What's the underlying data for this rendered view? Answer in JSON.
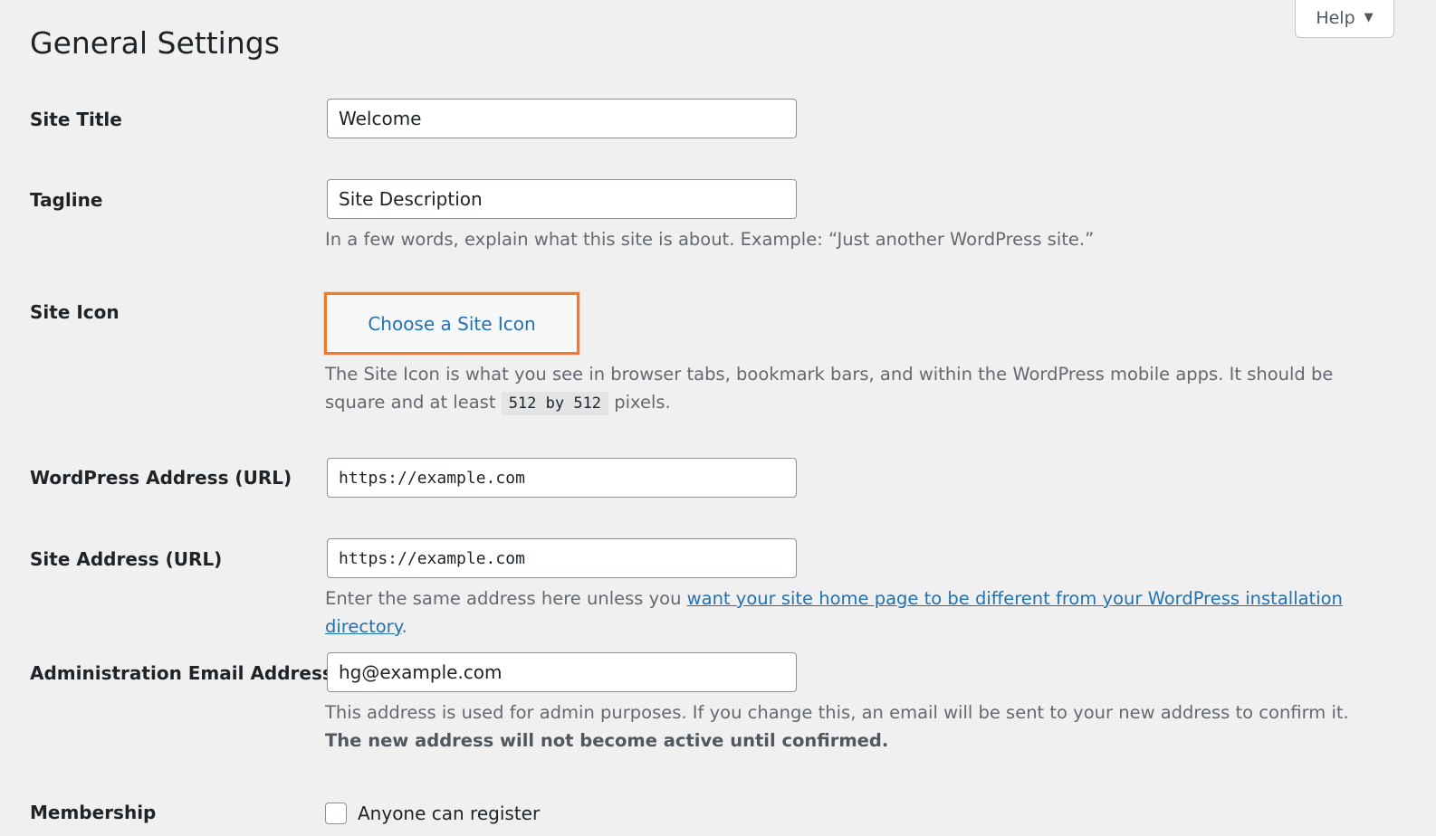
{
  "help": {
    "label": "Help",
    "caret": "▼"
  },
  "page_title": "General Settings",
  "site_title": {
    "label": "Site Title",
    "value": "Welcome"
  },
  "tagline": {
    "label": "Tagline",
    "value": "Site Description",
    "description": "In a few words, explain what this site is about. Example: “Just another WordPress site.”"
  },
  "site_icon": {
    "label": "Site Icon",
    "button_label": "Choose a Site Icon",
    "description_start": "The Site Icon is what you see in browser tabs, bookmark bars, and within the WordPress mobile apps. It should be square and at least ",
    "description_code": "512 by 512",
    "description_end": " pixels."
  },
  "wp_address": {
    "label": "WordPress Address (URL)",
    "value": "https://example.com"
  },
  "site_address": {
    "label": "Site Address (URL)",
    "value": "https://example.com",
    "description_start": "Enter the same address here unless you ",
    "description_link": "want your site home page to be different from your WordPress installation directory",
    "description_end": "."
  },
  "admin_email": {
    "label": "Administration Email Address",
    "value": "hg@example.com",
    "description_start": "This address is used for admin purposes. If you change this, an email will be sent to your new address to confirm it. ",
    "description_strong": "The new address will not become active until confirmed."
  },
  "membership": {
    "label": "Membership",
    "checkbox_label": "Anyone can register",
    "checked": false
  },
  "colors": {
    "accent_highlight": "#f07a2a",
    "link": "#2271b1",
    "background": "#f0f0f1"
  }
}
